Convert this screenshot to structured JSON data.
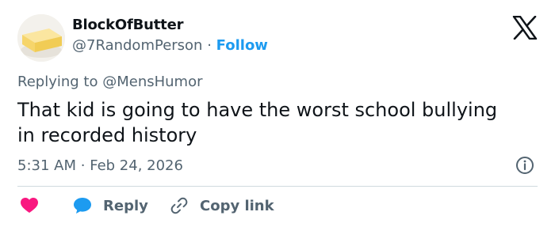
{
  "author": {
    "display_name": "BlockOfButter",
    "handle": "@7RandomPerson",
    "separator": "·",
    "follow_label": "Follow",
    "avatar_icon": "butter-avatar-icon"
  },
  "platform_icon": "x-logo-icon",
  "reply_context": {
    "prefix": "Replying to",
    "mention": "@MensHumor"
  },
  "tweet": {
    "text_line1": "That kid is going to have the worst school bullying",
    "text_line2": "in recorded history"
  },
  "meta": {
    "time": "5:31 AM",
    "separator": "·",
    "date": "Feb 24, 2026",
    "info_icon": "info-icon"
  },
  "actions": {
    "like_icon": "heart-icon",
    "reply_label": "Reply",
    "reply_icon": "reply-bubble-icon",
    "copy_label": "Copy link",
    "copy_icon": "link-icon"
  },
  "colors": {
    "text": "#0f1419",
    "secondary": "#536471",
    "accent": "#1d9bf0",
    "like": "#f91880",
    "divider": "#cfd9de"
  }
}
